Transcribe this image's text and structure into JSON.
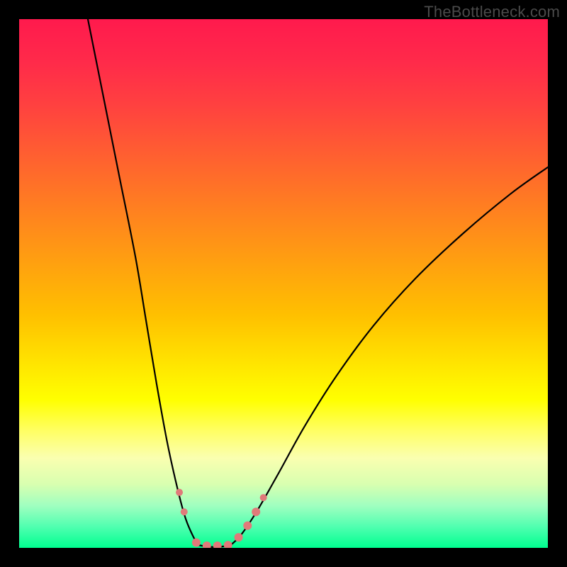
{
  "watermark": "TheBottleneck.com",
  "chart_data": {
    "type": "line",
    "title": "",
    "xlabel": "",
    "ylabel": "",
    "xlim": [
      0,
      100
    ],
    "ylim": [
      0,
      100
    ],
    "gradient_colors": {
      "top": "#ff1a4d",
      "mid": "#ffe000",
      "bottom": "#00ff90"
    },
    "series": [
      {
        "name": "left-curve",
        "color": "#000000",
        "x": [
          13,
          16,
          19,
          22,
          24,
          26,
          28,
          30,
          31.5,
          33,
          34
        ],
        "y": [
          100,
          85,
          70,
          55,
          43,
          31,
          20,
          11,
          5.5,
          2,
          0.5
        ]
      },
      {
        "name": "right-curve",
        "color": "#000000",
        "x": [
          40,
          42,
          45,
          49,
          54,
          60,
          67,
          75,
          84,
          93,
          100
        ],
        "y": [
          0.5,
          2.5,
          7,
          14,
          23,
          32.5,
          42,
          51,
          59.5,
          67,
          72
        ]
      },
      {
        "name": "bottom-flat",
        "color": "#000000",
        "x": [
          34,
          36,
          38,
          40
        ],
        "y": [
          0.5,
          0.2,
          0.2,
          0.5
        ]
      }
    ],
    "markers": [
      {
        "name": "left-dot-1",
        "x": 30.3,
        "y": 10.5,
        "r": 5,
        "color": "#e07a7a"
      },
      {
        "name": "left-dot-2",
        "x": 31.2,
        "y": 6.8,
        "r": 5,
        "color": "#e07a7a"
      },
      {
        "name": "bottom-dot-1",
        "x": 33.5,
        "y": 1.0,
        "r": 6,
        "color": "#e07a7a"
      },
      {
        "name": "bottom-dot-2",
        "x": 35.5,
        "y": 0.4,
        "r": 6,
        "color": "#e07a7a"
      },
      {
        "name": "bottom-dot-3",
        "x": 37.5,
        "y": 0.4,
        "r": 6,
        "color": "#e07a7a"
      },
      {
        "name": "bottom-dot-4",
        "x": 39.5,
        "y": 0.5,
        "r": 6,
        "color": "#e07a7a"
      },
      {
        "name": "right-dot-1",
        "x": 41.5,
        "y": 2.0,
        "r": 6,
        "color": "#e07a7a"
      },
      {
        "name": "right-dot-2",
        "x": 43.2,
        "y": 4.2,
        "r": 6,
        "color": "#e07a7a"
      },
      {
        "name": "right-dot-3",
        "x": 44.8,
        "y": 6.8,
        "r": 6,
        "color": "#e07a7a"
      },
      {
        "name": "right-dot-4",
        "x": 46.2,
        "y": 9.5,
        "r": 5,
        "color": "#e07a7a"
      }
    ]
  }
}
